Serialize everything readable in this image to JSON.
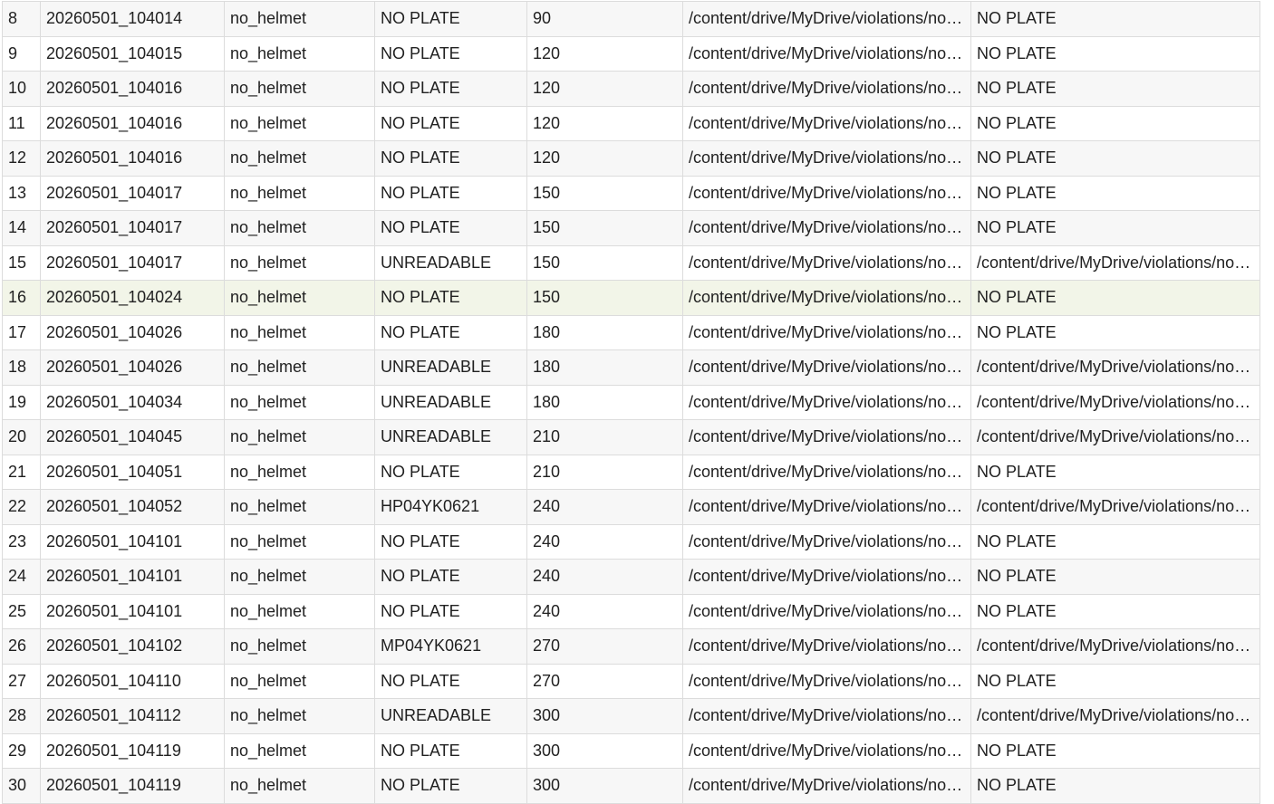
{
  "table": {
    "rows": [
      {
        "index": "8",
        "timestamp": "20260501_104014",
        "violation": "no_helmet",
        "plate": "NO PLATE",
        "fine": "90",
        "image_path": "/content/drive/MyDrive/violations/no_helmet",
        "plate_image": "NO PLATE"
      },
      {
        "index": "9",
        "timestamp": "20260501_104015",
        "violation": "no_helmet",
        "plate": "NO PLATE",
        "fine": "120",
        "image_path": "/content/drive/MyDrive/violations/no_helmet",
        "plate_image": "NO PLATE"
      },
      {
        "index": "10",
        "timestamp": "20260501_104016",
        "violation": "no_helmet",
        "plate": "NO PLATE",
        "fine": "120",
        "image_path": "/content/drive/MyDrive/violations/no_helmet",
        "plate_image": "NO PLATE"
      },
      {
        "index": "11",
        "timestamp": "20260501_104016",
        "violation": "no_helmet",
        "plate": "NO PLATE",
        "fine": "120",
        "image_path": "/content/drive/MyDrive/violations/no_helmet",
        "plate_image": "NO PLATE"
      },
      {
        "index": "12",
        "timestamp": "20260501_104016",
        "violation": "no_helmet",
        "plate": "NO PLATE",
        "fine": "120",
        "image_path": "/content/drive/MyDrive/violations/no_helmet",
        "plate_image": "NO PLATE"
      },
      {
        "index": "13",
        "timestamp": "20260501_104017",
        "violation": "no_helmet",
        "plate": "NO PLATE",
        "fine": "150",
        "image_path": "/content/drive/MyDrive/violations/no_helmet",
        "plate_image": "NO PLATE"
      },
      {
        "index": "14",
        "timestamp": "20260501_104017",
        "violation": "no_helmet",
        "plate": "NO PLATE",
        "fine": "150",
        "image_path": "/content/drive/MyDrive/violations/no_helmet",
        "plate_image": "NO PLATE"
      },
      {
        "index": "15",
        "timestamp": "20260501_104017",
        "violation": "no_helmet",
        "plate": "UNREADABLE",
        "fine": "150",
        "image_path": "/content/drive/MyDrive/violations/no_helmet",
        "plate_image": "/content/drive/MyDrive/violations/no_helmet"
      },
      {
        "index": "16",
        "timestamp": "20260501_104024",
        "violation": "no_helmet",
        "plate": "NO PLATE",
        "fine": "150",
        "image_path": "/content/drive/MyDrive/violations/no_helmet",
        "plate_image": "NO PLATE"
      },
      {
        "index": "17",
        "timestamp": "20260501_104026",
        "violation": "no_helmet",
        "plate": "NO PLATE",
        "fine": "180",
        "image_path": "/content/drive/MyDrive/violations/no_helmet",
        "plate_image": "NO PLATE"
      },
      {
        "index": "18",
        "timestamp": "20260501_104026",
        "violation": "no_helmet",
        "plate": "UNREADABLE",
        "fine": "180",
        "image_path": "/content/drive/MyDrive/violations/no_helmet",
        "plate_image": "/content/drive/MyDrive/violations/no_helmet"
      },
      {
        "index": "19",
        "timestamp": "20260501_104034",
        "violation": "no_helmet",
        "plate": "UNREADABLE",
        "fine": "180",
        "image_path": "/content/drive/MyDrive/violations/no_helmet",
        "plate_image": "/content/drive/MyDrive/violations/no_helmet"
      },
      {
        "index": "20",
        "timestamp": "20260501_104045",
        "violation": "no_helmet",
        "plate": "UNREADABLE",
        "fine": "210",
        "image_path": "/content/drive/MyDrive/violations/no_helmet",
        "plate_image": "/content/drive/MyDrive/violations/no_helmet"
      },
      {
        "index": "21",
        "timestamp": "20260501_104051",
        "violation": "no_helmet",
        "plate": "NO PLATE",
        "fine": "210",
        "image_path": "/content/drive/MyDrive/violations/no_helmet",
        "plate_image": "NO PLATE"
      },
      {
        "index": "22",
        "timestamp": "20260501_104052",
        "violation": "no_helmet",
        "plate": "HP04YK0621",
        "fine": "240",
        "image_path": "/content/drive/MyDrive/violations/no_helmet",
        "plate_image": "/content/drive/MyDrive/violations/no_helmet"
      },
      {
        "index": "23",
        "timestamp": "20260501_104101",
        "violation": "no_helmet",
        "plate": "NO PLATE",
        "fine": "240",
        "image_path": "/content/drive/MyDrive/violations/no_helmet",
        "plate_image": "NO PLATE"
      },
      {
        "index": "24",
        "timestamp": "20260501_104101",
        "violation": "no_helmet",
        "plate": "NO PLATE",
        "fine": "240",
        "image_path": "/content/drive/MyDrive/violations/no_helmet",
        "plate_image": "NO PLATE"
      },
      {
        "index": "25",
        "timestamp": "20260501_104101",
        "violation": "no_helmet",
        "plate": "NO PLATE",
        "fine": "240",
        "image_path": "/content/drive/MyDrive/violations/no_helmet",
        "plate_image": "NO PLATE"
      },
      {
        "index": "26",
        "timestamp": "20260501_104102",
        "violation": "no_helmet",
        "plate": "MP04YK0621",
        "fine": "270",
        "image_path": "/content/drive/MyDrive/violations/no_helmet",
        "plate_image": "/content/drive/MyDrive/violations/no_helmet"
      },
      {
        "index": "27",
        "timestamp": "20260501_104110",
        "violation": "no_helmet",
        "plate": "NO PLATE",
        "fine": "270",
        "image_path": "/content/drive/MyDrive/violations/no_helmet",
        "plate_image": "NO PLATE"
      },
      {
        "index": "28",
        "timestamp": "20260501_104112",
        "violation": "no_helmet",
        "plate": "UNREADABLE",
        "fine": "300",
        "image_path": "/content/drive/MyDrive/violations/no_helmet",
        "plate_image": "/content/drive/MyDrive/violations/no_helmet"
      },
      {
        "index": "29",
        "timestamp": "20260501_104119",
        "violation": "no_helmet",
        "plate": "NO PLATE",
        "fine": "300",
        "image_path": "/content/drive/MyDrive/violations/no_helmet",
        "plate_image": "NO PLATE"
      },
      {
        "index": "30",
        "timestamp": "20260501_104119",
        "violation": "no_helmet",
        "plate": "NO PLATE",
        "fine": "300",
        "image_path": "/content/drive/MyDrive/violations/no_helmet",
        "plate_image": "NO PLATE"
      }
    ],
    "highlighted_row_index": "16",
    "colors": {
      "row_even": "#f7f7f7",
      "row_odd": "#ffffff",
      "row_highlight": "#f2f5e8",
      "border": "#dcdcdc",
      "text": "#212121"
    }
  }
}
